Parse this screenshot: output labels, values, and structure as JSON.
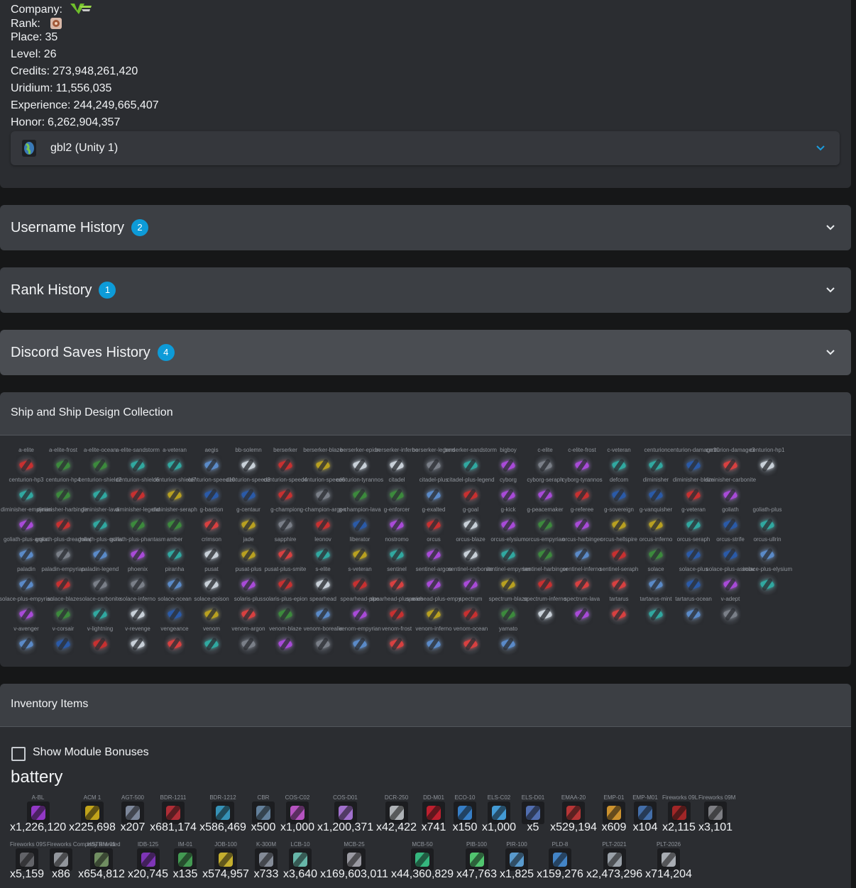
{
  "profile": {
    "company_label": "Company:",
    "company_logo": "vru-logo",
    "rank_label": "Rank:",
    "rank_icon": "rank-insignia-icon",
    "place_label": "Place:",
    "place": "35",
    "level_label": "Level:",
    "level": "26",
    "credits_label": "Credits:",
    "credits": "273,948,261,420",
    "uridium_label": "Uridium:",
    "uridium": "11,556,035",
    "experience_label": "Experience:",
    "experience": "244,249,665,407",
    "honor_label": "Honor:",
    "honor": "6,262,904,357",
    "server": "gbl2 (Unity 1)"
  },
  "accordions": [
    {
      "title": "Username History",
      "count": "2"
    },
    {
      "title": "Rank History",
      "count": "1"
    },
    {
      "title": "Discord Saves History",
      "count": "4"
    }
  ],
  "ships_section": {
    "title": "Ship and Ship Design Collection",
    "rows": [
      [
        "a-elite",
        "a-elite-frost",
        "a-elite-ocean",
        "a-elite-sandstorm",
        "a-veteran",
        "aegis",
        "bb-solemn",
        "berserker",
        "berserker-blaze",
        "berserker-epion",
        "berserker-inferno",
        "berserker-legend",
        "berserker-sandstorm",
        "bigboy",
        "c-elite",
        "c-elite-frost",
        "c-veteran",
        "centurion",
        "centurion-damage10",
        "centurion-damage3",
        "centurion-hp1"
      ],
      [
        "centurion-hp3",
        "centurion-hp4",
        "centurion-shield2",
        "centurion-shield6",
        "centurion-shield7",
        "centurion-speed10",
        "centurion-speed3",
        "centurion-speed4",
        "centurion-speed6",
        "centurion-tyrannos",
        "citadel",
        "citadel-plus",
        "citadel-plus-legend",
        "cyborg",
        "cyborg-seraph",
        "cyborg-tyrannos",
        "defcom",
        "diminisher",
        "diminisher-blaze",
        "diminisher-carbonite"
      ],
      [
        "diminisher-empyrian",
        "diminisher-harbinger",
        "diminisher-lava",
        "diminisher-legend",
        "diminisher-seraph",
        "g-bastion",
        "g-centaur",
        "g-champion",
        "g-champion-argon",
        "g-champion-lava",
        "g-enforcer",
        "g-exalted",
        "g-goal",
        "g-kick",
        "g-peacemaker",
        "g-referee",
        "g-sovereign",
        "g-vanquisher",
        "g-veteran",
        "goliath",
        "goliath-plus"
      ],
      [
        "goliath-plus-argon",
        "goliath-plus-dreadwing",
        "goliath-plus-osiris",
        "goliath-plus-phantasm",
        "amber",
        "crimson",
        "jade",
        "sapphire",
        "leonov",
        "liberator",
        "nostromo",
        "orcus",
        "orcus-blaze",
        "orcus-elysium",
        "orcus-empyrian",
        "orcus-harbinger",
        "orcus-hellspire",
        "orcus-inferno",
        "orcus-seraph",
        "orcus-strife",
        "orcus-ullrin"
      ],
      [
        "paladin",
        "paladin-empyrian",
        "paladin-legend",
        "phoenix",
        "piranha",
        "pusat",
        "pusat-plus",
        "pusat-plus-smite",
        "s-elite",
        "s-veteran",
        "sentinel",
        "sentinel-argon",
        "sentinel-carbonite",
        "sentinel-empyrian",
        "sentinel-harbinger",
        "sentinel-inferno",
        "sentinel-seraph",
        "solace",
        "solace-plus",
        "solace-plus-asimov",
        "solace-plus-elysium"
      ],
      [
        "solace-plus-empyrian",
        "solace-blaze",
        "solace-carbonite",
        "solace-inferno",
        "solace-ocean",
        "solace-poison",
        "solaris-plus",
        "solaris-plus-epion",
        "spearhead",
        "spearhead-plus",
        "spearhead-plus-arios",
        "spearhead-plus-empyrian",
        "spectrum",
        "spectrum-blaze",
        "spectrum-inferno",
        "spectrum-lava",
        "tartarus",
        "tartarus-mint",
        "tartarus-ocean",
        "v-adept"
      ],
      [
        "v-avenger",
        "v-corsair",
        "v-lightning",
        "v-revenge",
        "vengeance",
        "venom",
        "venom-argon",
        "venom-blaze",
        "venom-borealis",
        "venom-empyrian",
        "venom-frost",
        "venom-inferno",
        "venom-ocean",
        "yamato"
      ]
    ]
  },
  "inventory": {
    "title": "Inventory Items",
    "show_bonuses_label": "Show Module Bonuses",
    "category": "battery",
    "row1": [
      {
        "name": "A-BL",
        "qty": "x1,226,120",
        "color": "#a03cd8"
      },
      {
        "name": "ACM 1",
        "qty": "x225,698",
        "color": "#d4b21a"
      },
      {
        "name": "AGT-500",
        "qty": "x207",
        "color": "#8a95a8"
      },
      {
        "name": "BDR-1211",
        "qty": "x681,174",
        "color": "#c03038"
      },
      {
        "name": "BDR-1212",
        "qty": "x586,469",
        "color": "#3aa0c8"
      },
      {
        "name": "CBR",
        "qty": "x500",
        "color": "#6c8ca8"
      },
      {
        "name": "COS-C02",
        "qty": "x1,000",
        "color": "#c85ad2"
      },
      {
        "name": "COS-D01",
        "qty": "x1,200,371",
        "color": "#b07ae0"
      },
      {
        "name": "DCR-250",
        "qty": "x42,422",
        "color": "#c0c4c8"
      },
      {
        "name": "DD-M01",
        "qty": "x741",
        "color": "#d02030"
      },
      {
        "name": "ECO-10",
        "qty": "x150",
        "color": "#3a8ad8"
      },
      {
        "name": "ELS-C02",
        "qty": "x1,000",
        "color": "#48a8e8"
      },
      {
        "name": "ELS-D01",
        "qty": "x5",
        "color": "#5878c0"
      },
      {
        "name": "EMAA-20",
        "qty": "x529,194",
        "color": "#c83838"
      },
      {
        "name": "EMP-01",
        "qty": "x609",
        "color": "#e0a030"
      },
      {
        "name": "EMP-M01",
        "qty": "x104",
        "color": "#4878b8"
      },
      {
        "name": "Fireworks 09L",
        "qty": "x2,115",
        "color": "#b02828"
      },
      {
        "name": "Fireworks 09M",
        "qty": "x3,101",
        "color": "#888a8e"
      }
    ],
    "row2": [
      {
        "name": "Fireworks 09S",
        "qty": "x5,159",
        "color": "#6a6c70"
      },
      {
        "name": "Fireworks Company Branded",
        "qty": "x86",
        "color": "#a0a4aa"
      },
      {
        "name": "HSTRM-01",
        "qty": "x654,812",
        "color": "#7a9a68"
      },
      {
        "name": "IDB-125",
        "qty": "x20,745",
        "color": "#8a38c8"
      },
      {
        "name": "IM-01",
        "qty": "x135",
        "color": "#48a858"
      },
      {
        "name": "JOB-100",
        "qty": "x574,957",
        "color": "#d8c030"
      },
      {
        "name": "K-300M",
        "qty": "x733",
        "color": "#9098a4"
      },
      {
        "name": "LCB-10",
        "qty": "x3,640",
        "color": "#70c8b8"
      },
      {
        "name": "MCB-25",
        "qty": "x169,603,011",
        "color": "#a8a8b0"
      },
      {
        "name": "MCB-50",
        "qty": "x44,360,829",
        "color": "#38c888"
      },
      {
        "name": "PIB-100",
        "qty": "x47,763",
        "color": "#58d878"
      },
      {
        "name": "PIR-100",
        "qty": "x1,825",
        "color": "#60a8e0"
      },
      {
        "name": "PLD-8",
        "qty": "x159,276",
        "color": "#4890d8"
      },
      {
        "name": "PLT-2021",
        "qty": "x2,473,296",
        "color": "#a8b0b8"
      },
      {
        "name": "PLT-2026",
        "qty": "x714,204",
        "color": "#b8bcc2"
      }
    ]
  }
}
